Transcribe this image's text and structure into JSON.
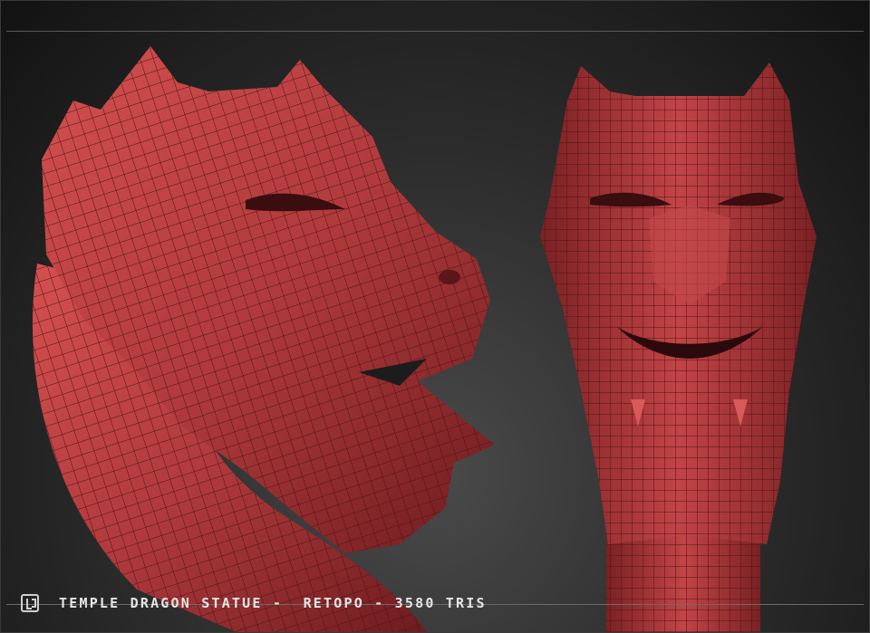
{
  "caption": {
    "title": "TEMPLE DRAGON STATUE",
    "sep1": " - ",
    "stage": "RETOPO",
    "sep2": " - ",
    "tris": "3580 TRIS"
  },
  "logo": {
    "icon": "studio-logo-icon"
  },
  "render": {
    "subject": "red wireframe dragon head sculpt",
    "views": [
      "side-view",
      "front-view"
    ],
    "accent": "#b83a3e",
    "wire": "#5a1618"
  }
}
